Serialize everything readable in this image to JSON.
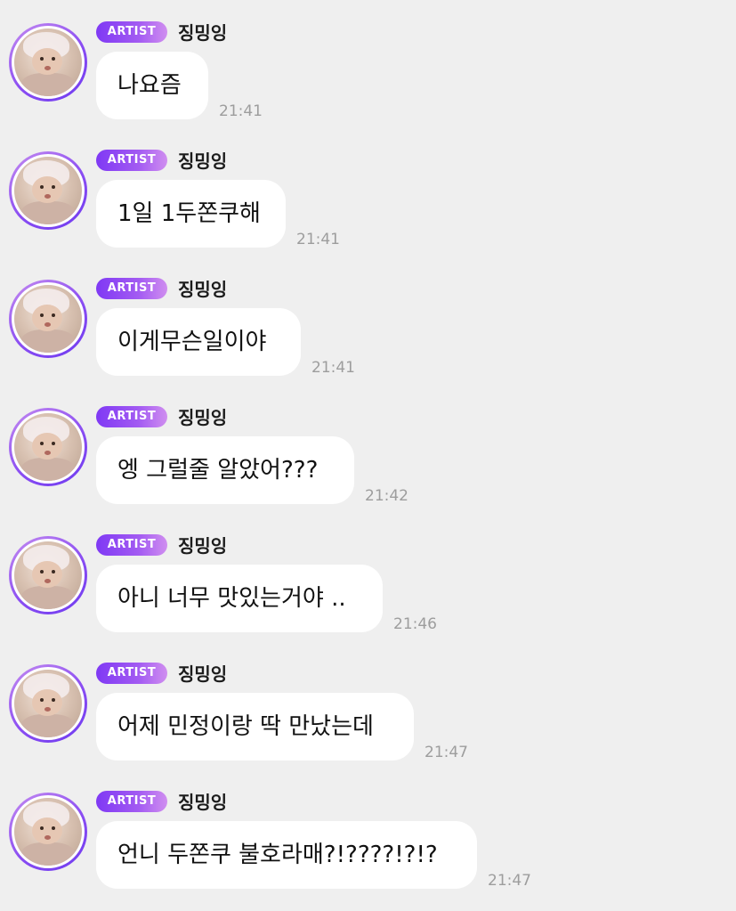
{
  "badge_label": "ARTIST",
  "colors": {
    "background": "#efefef",
    "bubble": "#ffffff",
    "badge_gradient_start": "#7f39f4",
    "badge_gradient_end": "#d08ef0",
    "timestamp": "#9d9d9d"
  },
  "messages": [
    {
      "sender": "징밍잉",
      "text": "나요즘",
      "time": "21:41"
    },
    {
      "sender": "징밍잉",
      "text": "1일 1두쫀쿠해",
      "time": "21:41"
    },
    {
      "sender": "징밍잉",
      "text": "이게무슨일이야",
      "time": "21:41"
    },
    {
      "sender": "징밍잉",
      "text": "엥 그럴줄 알았어???",
      "time": "21:42"
    },
    {
      "sender": "징밍잉",
      "text": "아니 너무 맛있는거야 ..",
      "time": "21:46"
    },
    {
      "sender": "징밍잉",
      "text": "어제 민정이랑 딱 만났는데",
      "time": "21:47"
    },
    {
      "sender": "징밍잉",
      "text": "언니 두쫀쿠 불호라매?!????!?!?",
      "time": "21:47"
    }
  ]
}
